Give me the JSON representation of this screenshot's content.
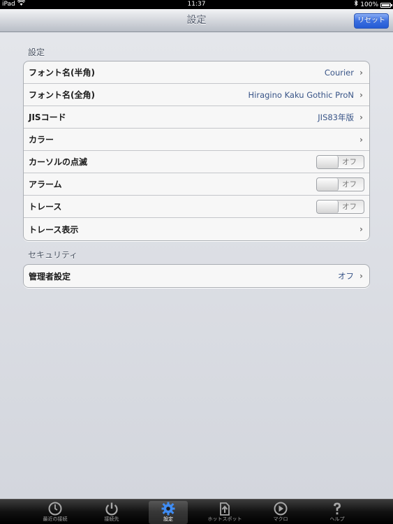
{
  "status_bar": {
    "device": "iPad",
    "time": "11:37",
    "battery": "100%"
  },
  "nav": {
    "title": "設定",
    "reset_label": "リセット"
  },
  "sections": {
    "settings": {
      "header": "設定",
      "rows": [
        {
          "label": "フォント名(半角)",
          "value": "Courier"
        },
        {
          "label": "フォント名(全角)",
          "value": "Hiragino Kaku Gothic ProN"
        },
        {
          "label": "JISコード",
          "value": "JIS83年版"
        },
        {
          "label": "カラー",
          "value": ""
        },
        {
          "label": "カーソルの点滅",
          "toggle": "オフ"
        },
        {
          "label": "アラーム",
          "toggle": "オフ"
        },
        {
          "label": "トレース",
          "toggle": "オフ"
        },
        {
          "label": "トレース表示",
          "value": ""
        }
      ]
    },
    "security": {
      "header": "セキュリティ",
      "rows": [
        {
          "label": "管理者設定",
          "value": "オフ"
        }
      ]
    }
  },
  "tabs": [
    {
      "label": "最近の接続",
      "icon": "clock-icon"
    },
    {
      "label": "接続先",
      "icon": "power-icon"
    },
    {
      "label": "設定",
      "icon": "gear-icon"
    },
    {
      "label": "ホットスポット",
      "icon": "upload-icon"
    },
    {
      "label": "マクロ",
      "icon": "play-icon"
    },
    {
      "label": "ヘルプ",
      "icon": "question-icon"
    }
  ],
  "colors": {
    "accent_blue": "#2f63dc",
    "value_text": "#385487",
    "background": "#d8dbe2"
  }
}
